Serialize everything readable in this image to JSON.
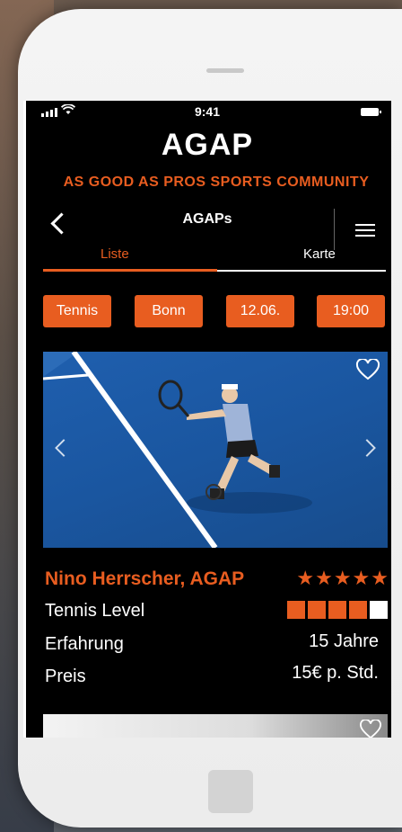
{
  "status": {
    "time": "9:41"
  },
  "app": {
    "title": "AGAP",
    "subtitle": "AS GOOD AS PROS SPORTS COMMUNITY"
  },
  "nav": {
    "title": "AGAPs",
    "tabs": [
      {
        "label": "Liste",
        "active": true
      },
      {
        "label": "Karte",
        "active": false
      }
    ]
  },
  "filters": [
    "Tennis",
    "Bonn",
    "12.06.",
    "19:00"
  ],
  "card": {
    "name": "Nino Herrscher, AGAP",
    "rating_stars": "★★★★★",
    "rows": [
      {
        "label": "Tennis Level",
        "value": ""
      },
      {
        "label": "Erfahrung",
        "value": "15 Jahre"
      },
      {
        "label": "Preis",
        "value": "15€ p. Std."
      }
    ],
    "tennis_level": {
      "filled": 4,
      "total": 5
    }
  },
  "colors": {
    "accent": "#e85d20",
    "background": "#000000",
    "court": "#1f5fae"
  }
}
